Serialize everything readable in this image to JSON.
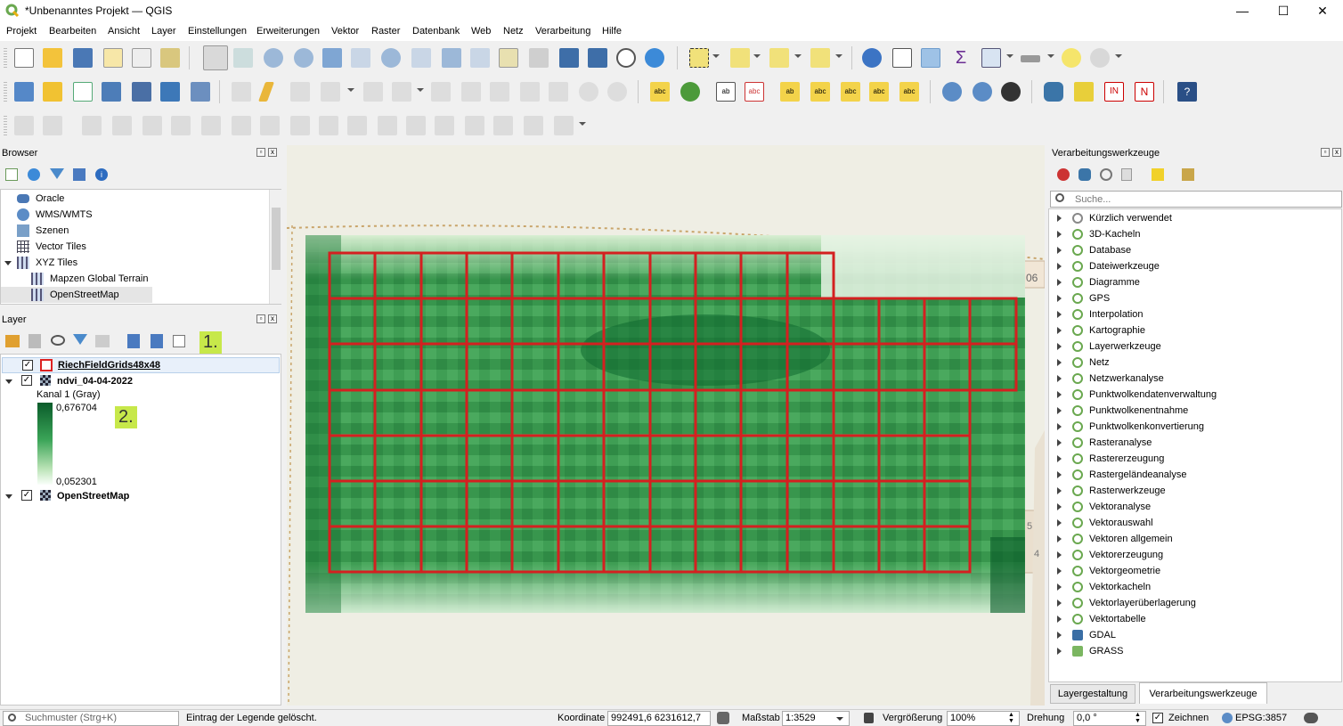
{
  "window": {
    "title": "*Unbenanntes Projekt — QGIS",
    "minimize": "—",
    "maximize": "☐",
    "close": "✕"
  },
  "menu": [
    "Projekt",
    "Bearbeiten",
    "Ansicht",
    "Layer",
    "Einstellungen",
    "Erweiterungen",
    "Vektor",
    "Raster",
    "Datenbank",
    "Web",
    "Netz",
    "Verarbeitung",
    "Hilfe"
  ],
  "browser": {
    "title": "Browser",
    "items": [
      "Oracle",
      "WMS/WMTS",
      "Szenen",
      "Vector Tiles",
      "XYZ Tiles",
      "Mapzen Global Terrain",
      "OpenStreetMap"
    ]
  },
  "layers": {
    "title": "Layer",
    "marker1": "1.",
    "marker2": "2.",
    "items": {
      "grid": "RiechFieldGrids48x48",
      "ndvi": "ndvi_04-04-2022",
      "band": "Kanal 1 (Gray)",
      "max": "0,676704",
      "min": "0,052301",
      "osm": "OpenStreetMap"
    }
  },
  "map": {
    "label_06": "06",
    "label_5": "5",
    "label_4": "4"
  },
  "processing": {
    "title": "Verarbeitungswerkzeuge",
    "search_placeholder": "Suche...",
    "items": [
      "Kürzlich verwendet",
      "3D-Kacheln",
      "Database",
      "Dateiwerkzeuge",
      "Diagramme",
      "GPS",
      "Interpolation",
      "Kartographie",
      "Layerwerkzeuge",
      "Netz",
      "Netzwerkanalyse",
      "Punktwolkendatenverwaltung",
      "Punktwolkenentnahme",
      "Punktwolkenkonvertierung",
      "Rasteranalyse",
      "Rastererzeugung",
      "Rastergeländeanalyse",
      "Rasterwerkzeuge",
      "Vektoranalyse",
      "Vektorauswahl",
      "Vektoren allgemein",
      "Vektorerzeugung",
      "Vektorgeometrie",
      "Vektorkacheln",
      "Vektorlayerüberlagerung",
      "Vektortabelle",
      "GDAL",
      "GRASS"
    ],
    "tabs": [
      "Layergestaltung",
      "Verarbeitungswerkzeuge"
    ]
  },
  "status": {
    "search_placeholder": "Suchmuster (Strg+K)",
    "message": "Eintrag der Legende gelöscht.",
    "coord_label": "Koordinate",
    "coord_value": "992491,6  6231612,7",
    "scale_label": "Maßstab",
    "scale_value": "1:3529",
    "zoom_label": "Vergrößerung",
    "zoom_value": "100%",
    "rotation_label": "Drehung",
    "rotation_value": "0,0 °",
    "render_label": "Zeichnen",
    "crs": "EPSG:3857"
  }
}
